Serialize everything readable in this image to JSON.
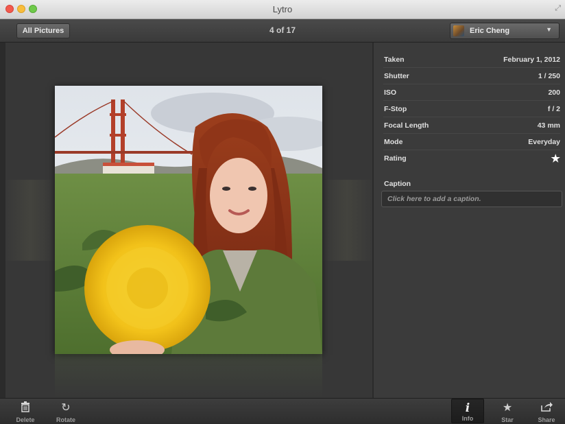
{
  "window": {
    "title": "Lytro"
  },
  "toolbar": {
    "all_pictures_label": "All Pictures",
    "counter": "4 of 17",
    "user": {
      "name": "Eric Cheng",
      "dropdown_icon": "chevron-down-icon"
    }
  },
  "info": {
    "rows": [
      {
        "label": "Taken",
        "value": "February 1, 2012"
      },
      {
        "label": "Shutter",
        "value": "1 / 250"
      },
      {
        "label": "ISO",
        "value": "200"
      },
      {
        "label": "F-Stop",
        "value": "f / 2"
      },
      {
        "label": "Focal Length",
        "value": "43 mm"
      },
      {
        "label": "Mode",
        "value": "Everyday"
      },
      {
        "label": "Rating",
        "value": "★"
      }
    ],
    "caption_label": "Caption",
    "caption_placeholder": "Click here to add a caption."
  },
  "bottom_toolbar": {
    "delete_label": "Delete",
    "rotate_label": "Rotate",
    "info_label": "Info",
    "star_label": "Star",
    "share_label": "Share"
  },
  "colors": {
    "panel_bg": "#3b3b3b",
    "viewer_bg": "#373737",
    "toolbar_bg": "#444444"
  }
}
